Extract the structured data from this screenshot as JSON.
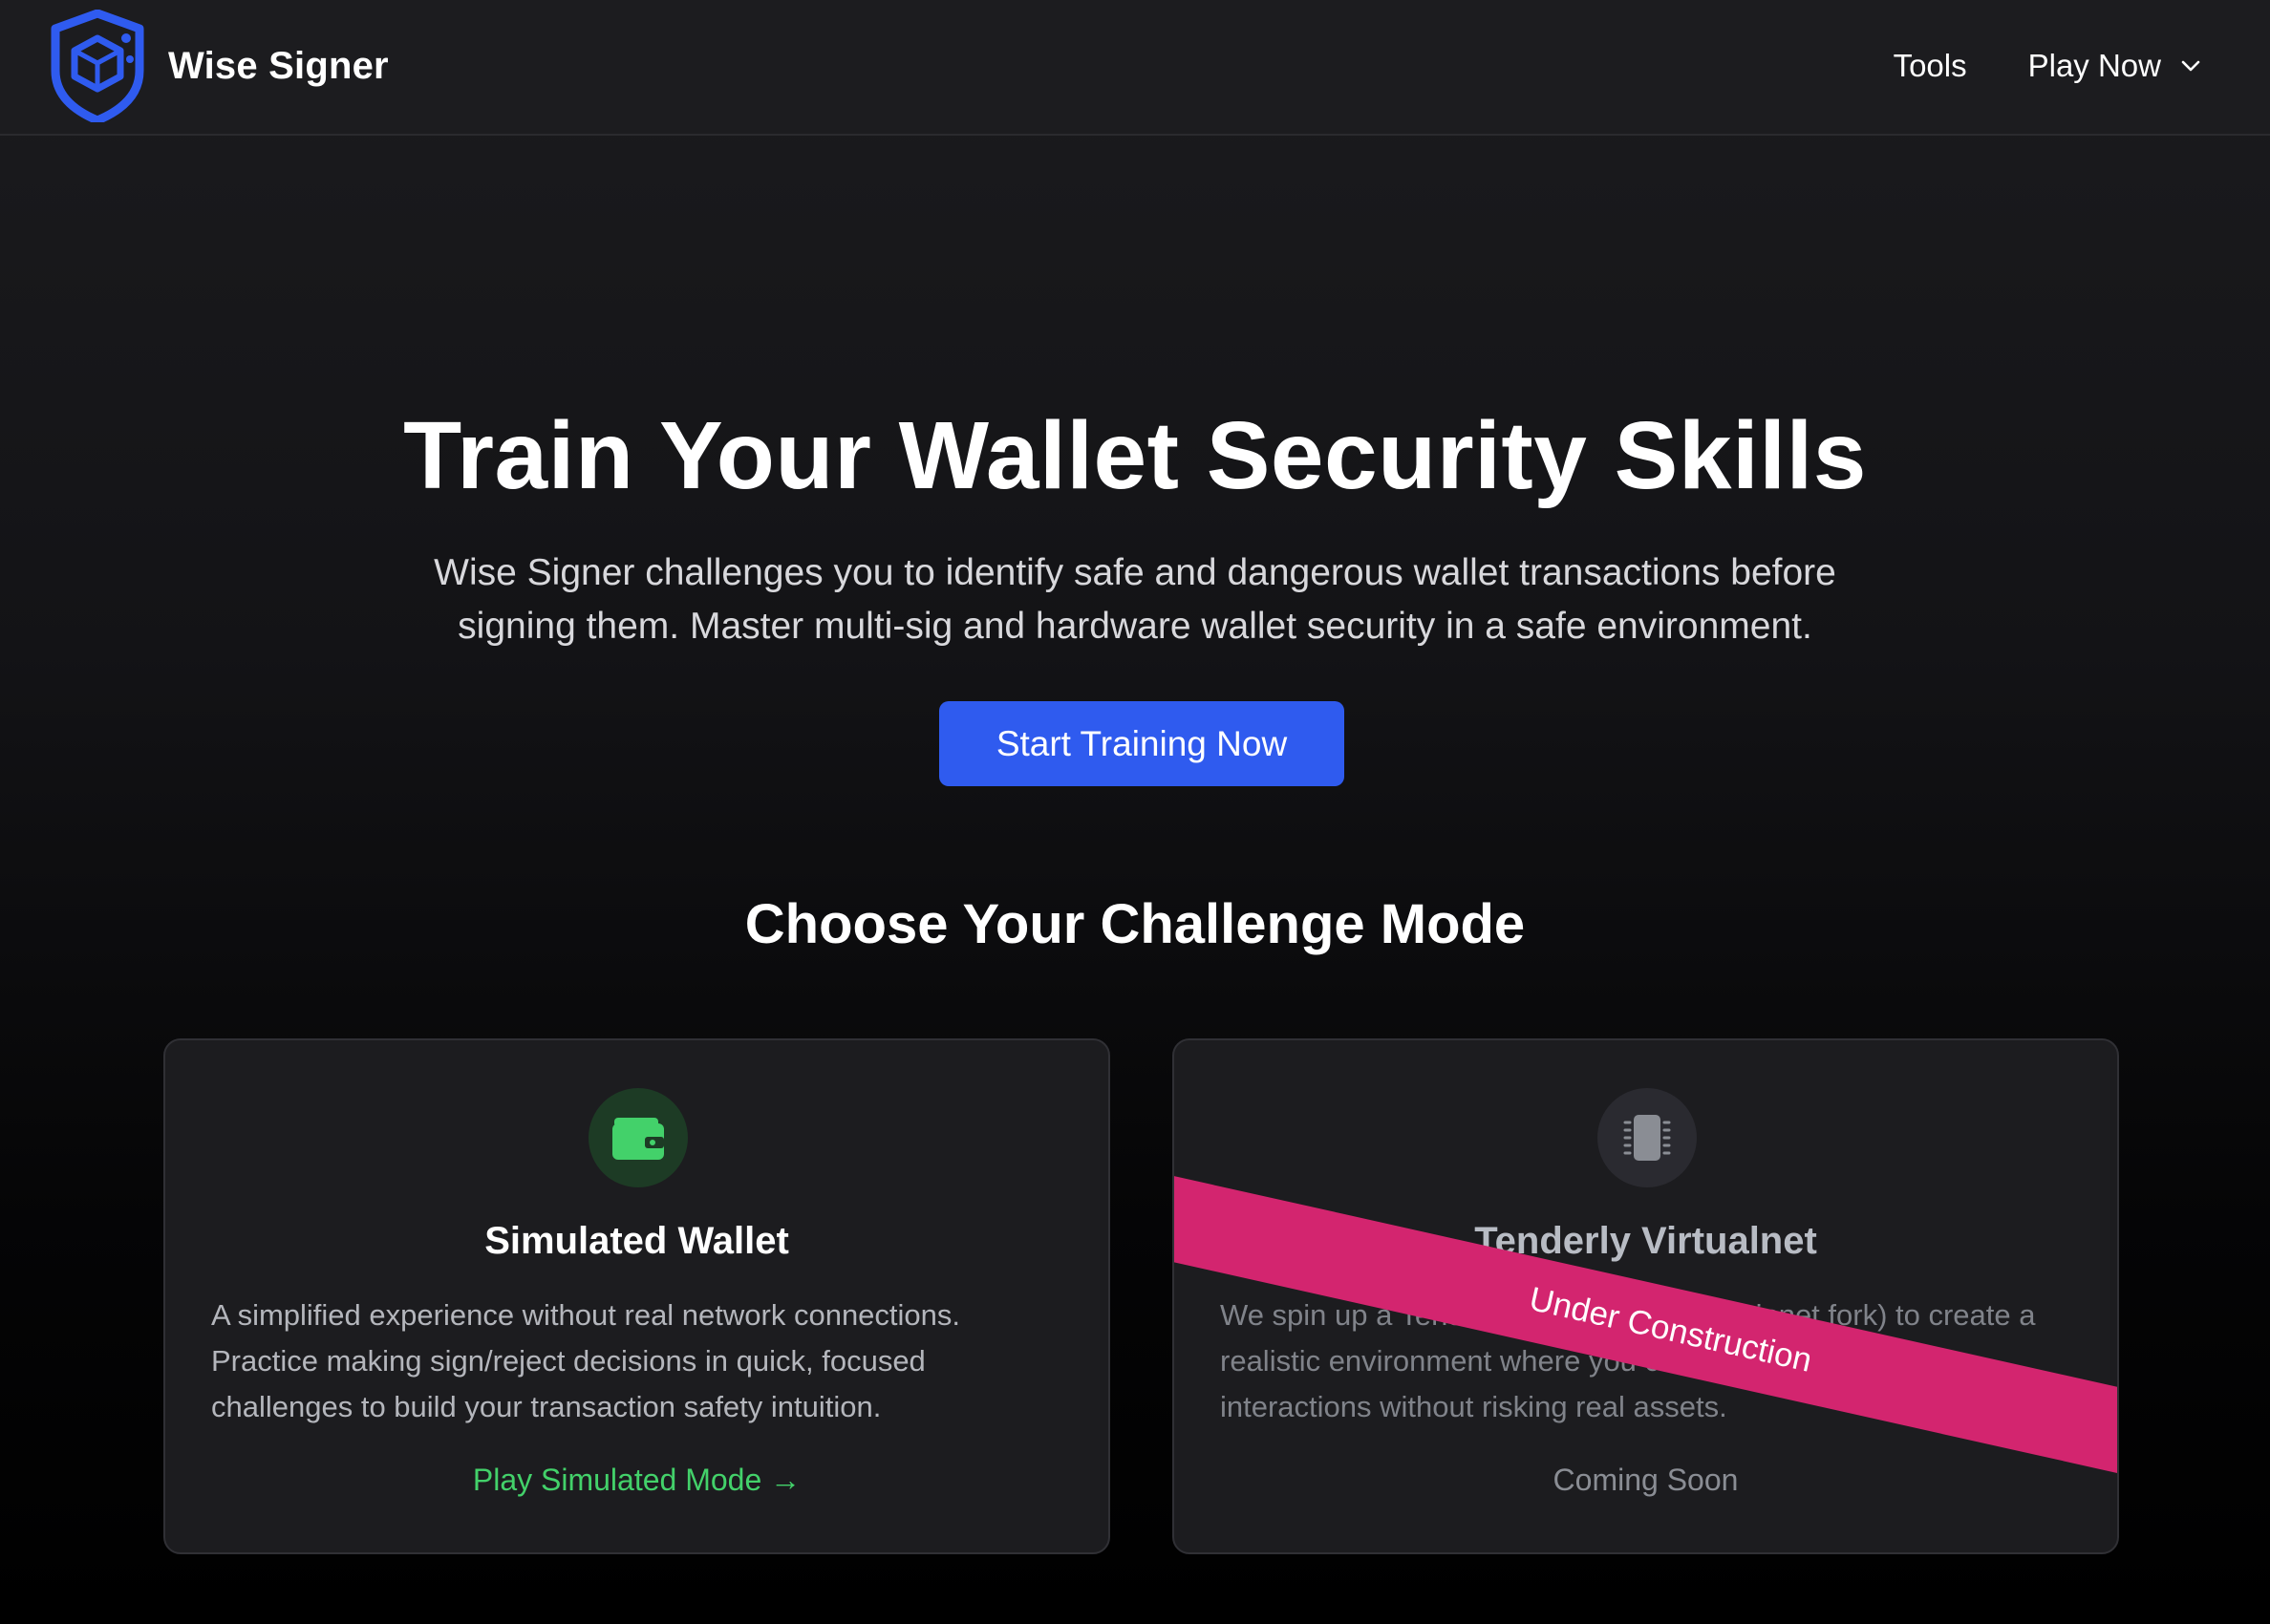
{
  "brand": {
    "name": "Wise Signer",
    "logo_icon": "shield-cube-icon",
    "accent": "#2f5bef"
  },
  "nav": {
    "tools": "Tools",
    "play_now": "Play Now"
  },
  "hero": {
    "title": "Train Your Wallet Security Skills",
    "subtitle": "Wise Signer challenges you to identify safe and dangerous wallet transactions before signing them. Master multi-sig and hardware wallet security in a safe environment.",
    "cta": "Start Training Now"
  },
  "section": {
    "title": "Choose Your Challenge Mode"
  },
  "cards": [
    {
      "icon": "wallet-icon",
      "title": "Simulated Wallet",
      "description": "A simplified experience without real network connections. Practice making sign/reject decisions in quick, focused challenges to build your transaction safety intuition.",
      "link": "Play Simulated Mode →",
      "accent": "#43d16a"
    },
    {
      "icon": "chip-icon",
      "title": "Tenderly Virtualnet",
      "description": "We spin up a Tenderly virtual testnet (mainnet fork) to create a realistic environment where you can practice blockchain interactions without risking real assets.",
      "link": "Coming Soon",
      "ribbon": "Under Construction",
      "ribbon_color": "#d3256f"
    }
  ]
}
